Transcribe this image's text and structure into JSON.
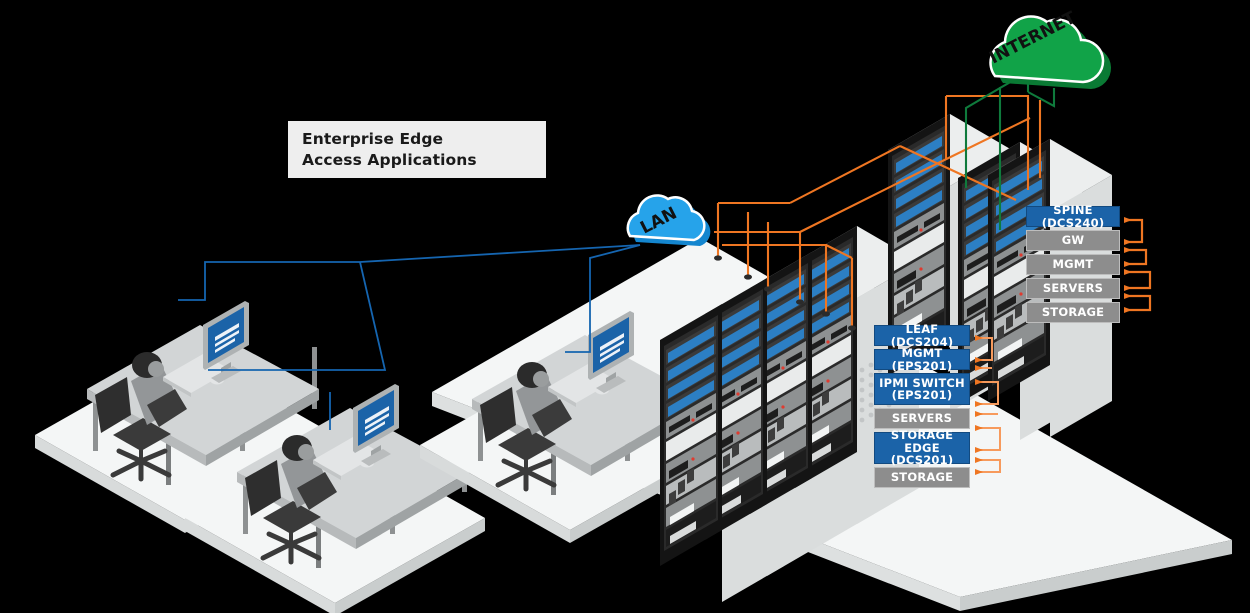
{
  "diagram": {
    "title_box": {
      "line1": "Enterprise Edge",
      "line2": "Access Applications"
    },
    "clouds": [
      {
        "name": "lan-cloud",
        "label": "LAN",
        "color": "#1a9ae0"
      },
      {
        "name": "internet-cloud",
        "label": "INTERNET",
        "color": "#0f9a43"
      }
    ],
    "legend_left": {
      "rows": [
        {
          "label": "LEAF (DCS204)",
          "style": "blue"
        },
        {
          "label": "MGMT (EPS201)",
          "style": "blue"
        },
        {
          "label": "IPMI SWITCH (EPS201)",
          "style": "blue"
        },
        {
          "label": "SERVERS",
          "style": "gray"
        },
        {
          "label": "STORAGE EDGE (DCS201)",
          "style": "blue"
        },
        {
          "label": "STORAGE",
          "style": "gray"
        }
      ]
    },
    "legend_right": {
      "rows": [
        {
          "label": "SPINE (DCS240)",
          "style": "blue"
        },
        {
          "label": "GW",
          "style": "gray"
        },
        {
          "label": "MGMT",
          "style": "gray"
        },
        {
          "label": "SERVERS",
          "style": "gray"
        },
        {
          "label": "STORAGE",
          "style": "gray"
        }
      ]
    },
    "colors": {
      "accent_blue": "#1b63a8",
      "legend_gray": "#8d8d8d",
      "cable_orange": "#ef7622",
      "cable_green": "#0f7a3c",
      "link_blue": "#1565b0",
      "platform": "#f4f6f6",
      "background": "#000000"
    },
    "workstations": [
      {
        "name": "workstation-1"
      },
      {
        "name": "workstation-2"
      },
      {
        "name": "workstation-3"
      }
    ],
    "racks": {
      "main_cluster_count": 4,
      "back_rack_count": 2,
      "spine_rack_count": 1
    }
  }
}
